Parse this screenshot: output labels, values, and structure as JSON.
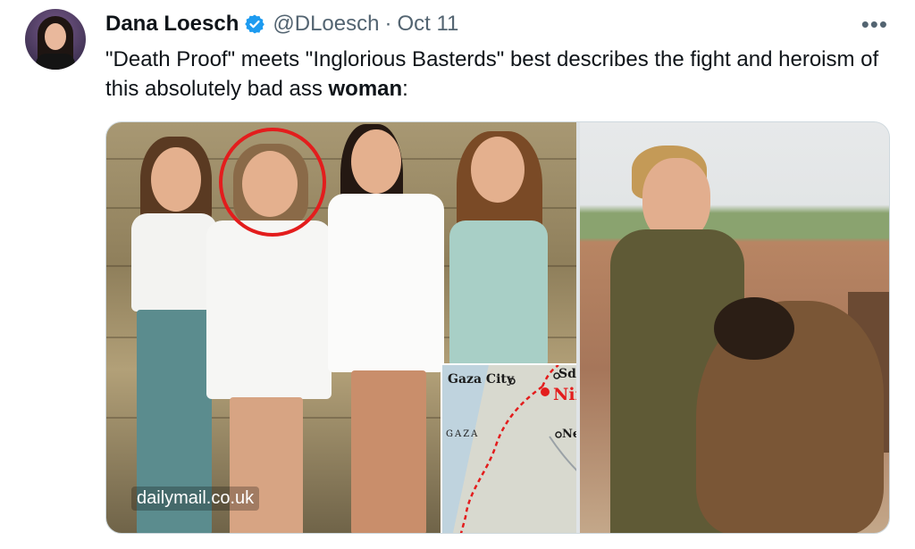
{
  "author": {
    "name": "Dana Loesch",
    "handle": "@DLoesch",
    "separator": "·",
    "date": "Oct 11",
    "verified": true
  },
  "more_icon": "more-options-icon",
  "tweet": {
    "text_before": "\"Death Proof\" meets \"Inglorious Basterds\" best describes the fight and heroism of this absolutely bad ass ",
    "text_bold": "woman",
    "text_after": ":"
  },
  "media": {
    "watermark": "dailymail.co.uk",
    "map_labels": {
      "gaza_city": "Gaza City",
      "sderot": "Sderot",
      "nir_am": "Nir Am",
      "gaza": "GAZA",
      "netivot": "Netivot"
    }
  },
  "colors": {
    "accent_blue": "#1d9bf0",
    "highlight_red": "#e31d1d",
    "text_primary": "#0f1419",
    "text_secondary": "#536471"
  }
}
